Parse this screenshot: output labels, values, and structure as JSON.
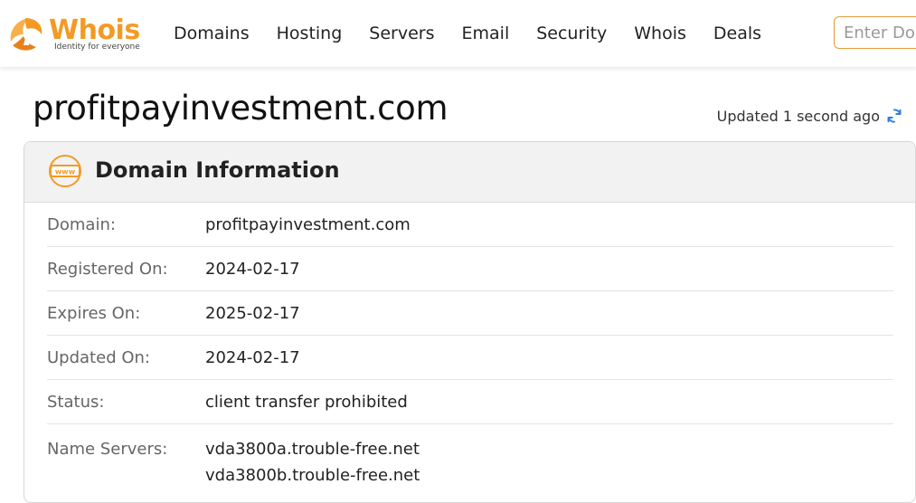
{
  "brand": {
    "name": "Whois",
    "tagline": "Identity for everyone",
    "accent_color": "#f39a25"
  },
  "nav": {
    "items": [
      "Domains",
      "Hosting",
      "Servers",
      "Email",
      "Security",
      "Whois",
      "Deals"
    ]
  },
  "search": {
    "placeholder": "Enter Domain or IP"
  },
  "page": {
    "title": "profitpayinvestment.com",
    "updated_text": "Updated 1 second ago",
    "refresh_icon": "refresh-icon"
  },
  "domain_info": {
    "heading": "Domain Information",
    "icon": "www-icon",
    "rows": [
      {
        "label": "Domain:",
        "value": "profitpayinvestment.com"
      },
      {
        "label": "Registered On:",
        "value": "2024-02-17"
      },
      {
        "label": "Expires On:",
        "value": "2025-02-17"
      },
      {
        "label": "Updated On:",
        "value": "2024-02-17"
      },
      {
        "label": "Status:",
        "value": "client transfer prohibited"
      }
    ],
    "name_servers": {
      "label": "Name Servers:",
      "values": [
        "vda3800a.trouble-free.net",
        "vda3800b.trouble-free.net"
      ]
    }
  }
}
